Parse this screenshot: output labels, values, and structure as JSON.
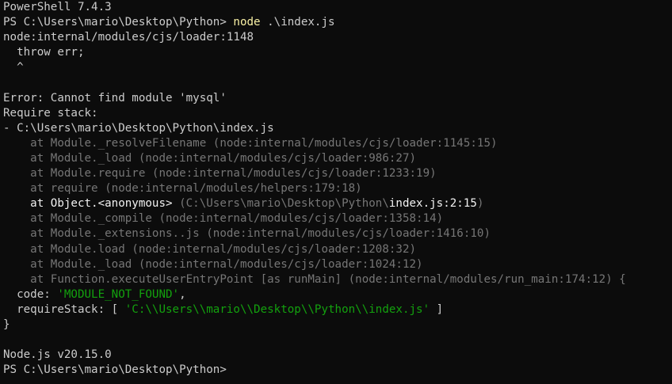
{
  "terminal": {
    "banner": "PowerShell 7.4.3",
    "prompt": "PS C:\\Users\\mario\\Desktop\\Python> ",
    "cmd_node": "node",
    "cmd_arg": " .\\index.js",
    "loader_line": "node:internal/modules/cjs/loader:1148",
    "throw_line": "  throw err;",
    "caret_line": "  ^",
    "error_line": "Error: Cannot find module 'mysql'",
    "require_stack_label": "Require stack:",
    "require_stack_item": "- C:\\Users\\mario\\Desktop\\Python\\index.js",
    "stack": [
      "    at Module._resolveFilename (node:internal/modules/cjs/loader:1145:15)",
      "    at Module._load (node:internal/modules/cjs/loader:986:27)",
      "    at Module.require (node:internal/modules/cjs/loader:1233:19)",
      "    at require (node:internal/modules/helpers:179:18)"
    ],
    "anon_frame": {
      "prefix": "    at Object.<anonymous> ",
      "path_open": "(C:\\Users\\mario\\Desktop\\Python\\",
      "file": "index.js:2:15",
      "path_close": ")"
    },
    "stack2": [
      "    at Module._compile (node:internal/modules/cjs/loader:1358:14)",
      "    at Module._extensions..js (node:internal/modules/cjs/loader:1416:10)",
      "    at Module.load (node:internal/modules/cjs/loader:1208:32)",
      "    at Module._load (node:internal/modules/cjs/loader:1024:12)",
      "    at Function.executeUserEntryPoint [as runMain] (node:internal/modules/run_main:174:12) {"
    ],
    "code_key": "  code: ",
    "code_value": "'MODULE_NOT_FOUND'",
    "code_comma": ",",
    "require_stack_key": "  requireStack: [ ",
    "require_stack_value": "'C:\\\\Users\\\\mario\\\\Desktop\\\\Python\\\\index.js'",
    "require_stack_close": " ]",
    "close_brace": "}",
    "version_line": "Node.js v20.15.0",
    "final_prompt": "PS C:\\Users\\mario\\Desktop\\Python>"
  }
}
